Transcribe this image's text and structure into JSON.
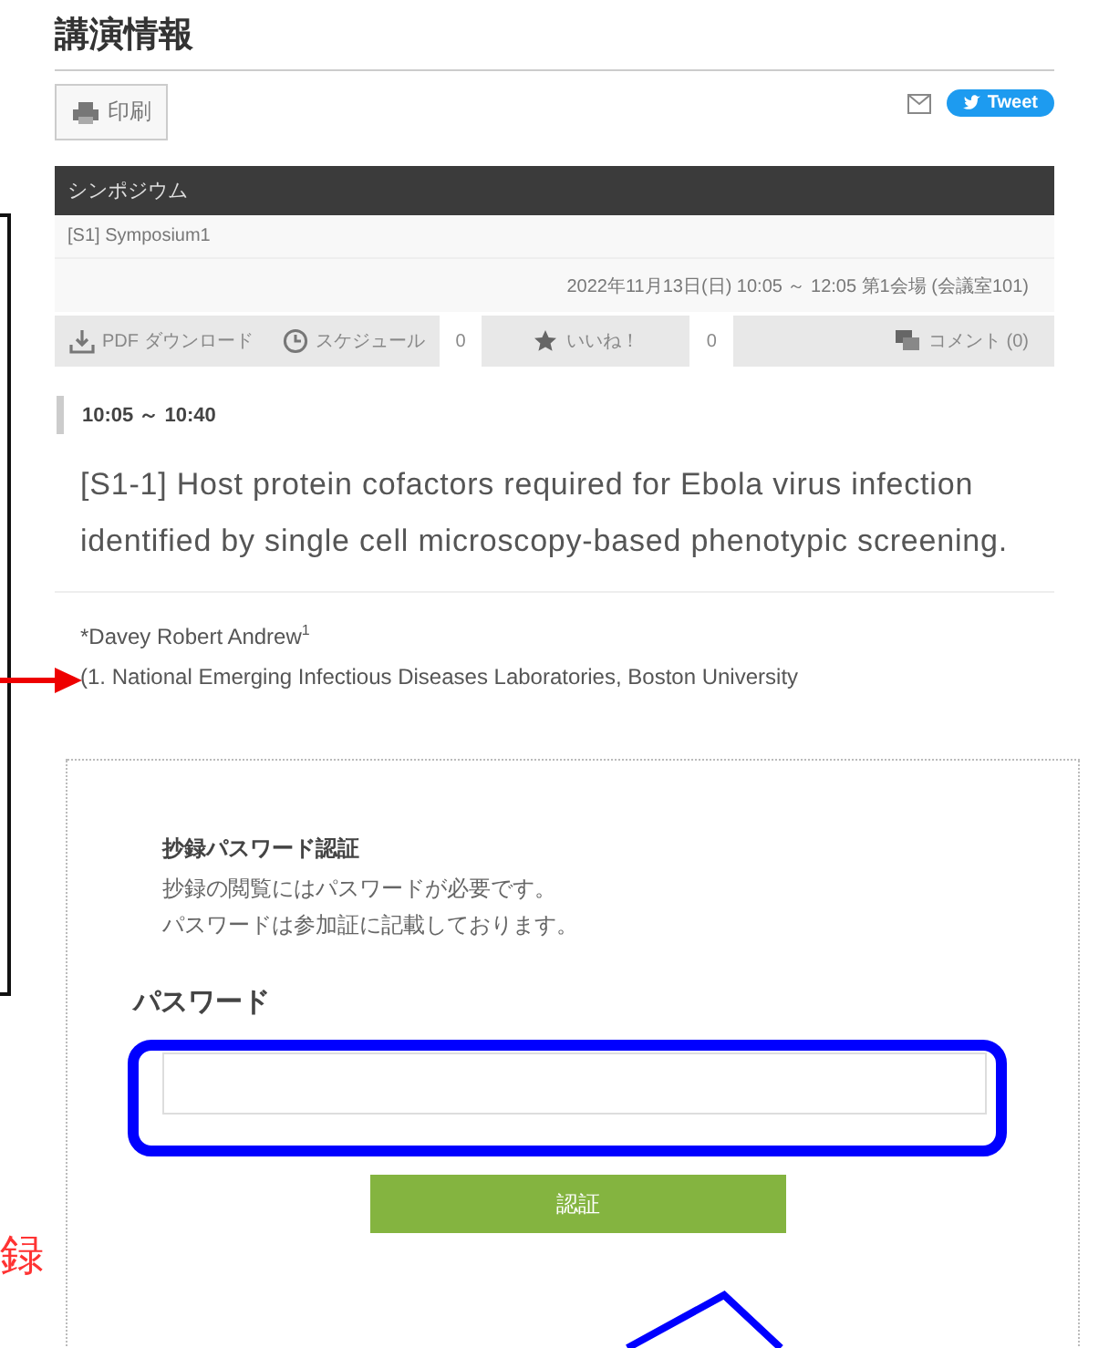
{
  "heading": "講演情報",
  "print_button": "印刷",
  "tweet_button": "Tweet",
  "category_bar": "シンポジウム",
  "session": "[S1] Symposium1",
  "session_datetime": "2022年11月13日(日) 10:05 ～ 12:05 第1会場 (会議室101)",
  "toolbar": [
    {
      "kind": "download",
      "label": "PDF ダウンロード"
    },
    {
      "kind": "schedule",
      "label": "スケジュール"
    },
    {
      "kind": "count",
      "label": "0"
    },
    {
      "kind": "like",
      "label": "いいね！"
    },
    {
      "kind": "count",
      "label": "0"
    },
    {
      "kind": "comment",
      "label": "コメント (0)"
    }
  ],
  "time": "10:05 ～ 10:40",
  "title": "[S1-1] Host protein cofactors required for Ebola virus infection identified by single cell microscopy-based phenotypic screening.",
  "author": "*Davey Robert Andrew$^{1}$",
  "affiliation": "(1. National Emerging Infectious Diseases Laboratories, Boston University",
  "password_panel": {
    "title": "抄録パスワード認証",
    "lines": [
      "抄録の閲覧にはパスワードが必要です。",
      "パスワードは参加証に記載しております。"
    ],
    "field_label": "パスワード",
    "submit_button": "認証"
  },
  "side_note": "録"
}
